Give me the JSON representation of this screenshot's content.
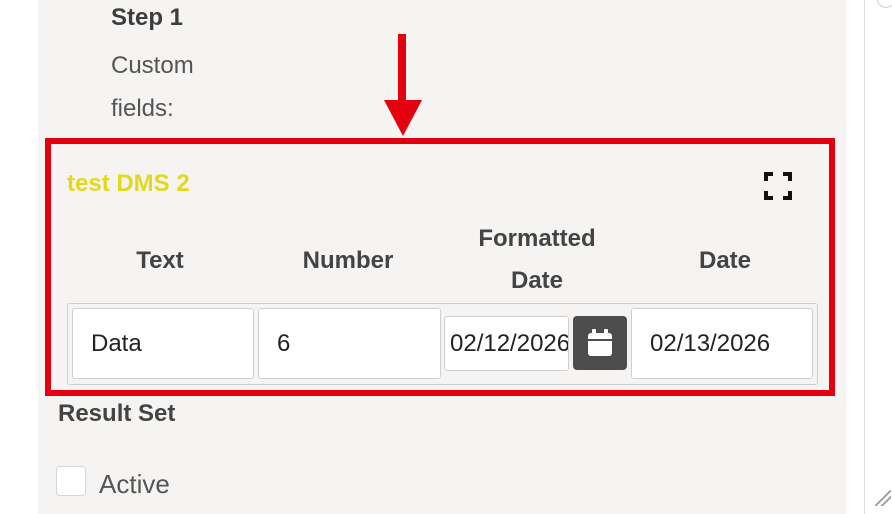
{
  "step": {
    "title": "Step 1",
    "description": "Custom fields:"
  },
  "custom_fields": {
    "title": "test DMS 2",
    "title_color": "#e3d91a",
    "expand_icon": "expand-icon",
    "columns": [
      "Text",
      "Number",
      "Formatted Date",
      "Date"
    ],
    "row": {
      "text_value": "Data",
      "number_value": "6",
      "formatted_date_value": "02/12/2026",
      "date_value": "02/13/2026"
    },
    "calendar_icon": "calendar-icon"
  },
  "annotation": {
    "color": "#e3000f",
    "arrow_icon": "arrow-down-icon"
  },
  "result_set": {
    "title": "Result Set",
    "active_label": "Active",
    "active_checked": false
  }
}
